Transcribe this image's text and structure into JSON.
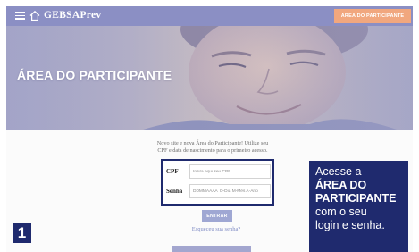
{
  "header": {
    "brand": "GEBSAPrev",
    "cta_label": "ÁREA DO PARTICIPANTE",
    "bar_color": "#8b8fc4",
    "cta_color": "#f1a77e",
    "icons": [
      "menu-icon",
      "home-icon"
    ]
  },
  "hero": {
    "title": "ÁREA DO PARTICIPANTE"
  },
  "login": {
    "intro_line1": "Novo site e nova Área do Participante! Utilize seu",
    "intro_line2": "CPF e data de nascimento para o primeiro acesso.",
    "cpf_label": "CPF",
    "cpf_placeholder": "Insira aqui seu CPF",
    "senha_label": "Senha",
    "senha_placeholder": "DDMMAAAA  D-Dia M-Mês A-Ano",
    "enter_label": "ENTRAR",
    "forgot_label": "Esqueceu sua senha?",
    "bottom_button_label": ""
  },
  "annotation": {
    "step_number": "1",
    "line1": "Acesse a",
    "line2": "ÁREA DO",
    "line3": "PARTICIPANTE",
    "line4": "com o seu",
    "line5": "login e senha.",
    "accent_color": "#1f2a6e"
  }
}
